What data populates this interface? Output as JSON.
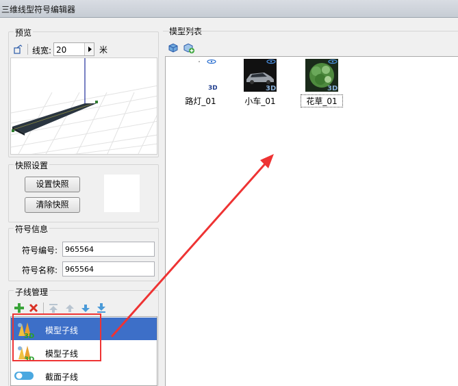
{
  "window": {
    "title": "三维线型符号编辑器"
  },
  "preview": {
    "group_label": "预览",
    "line_width_label": "线宽:",
    "line_width_value": "20",
    "unit": "米"
  },
  "snapshot": {
    "group_label": "快照设置",
    "set_button": "设置快照",
    "clear_button": "清除快照"
  },
  "symbol_info": {
    "group_label": "符号信息",
    "id_label": "符号编号:",
    "id_value": "965564",
    "name_label": "符号名称:",
    "name_value": "965564"
  },
  "subline": {
    "group_label": "子线管理",
    "items": [
      {
        "label": "模型子线",
        "selected": true
      },
      {
        "label": "模型子线",
        "selected": false
      },
      {
        "label": "截面子线",
        "selected": false
      }
    ]
  },
  "model_list": {
    "group_label": "模型列表",
    "items": [
      {
        "label": "路灯_01"
      },
      {
        "label": "小车_01"
      },
      {
        "label": "花草_01"
      }
    ]
  },
  "colors": {
    "selection": "#3d6fc8",
    "annotation": "#e33333"
  }
}
